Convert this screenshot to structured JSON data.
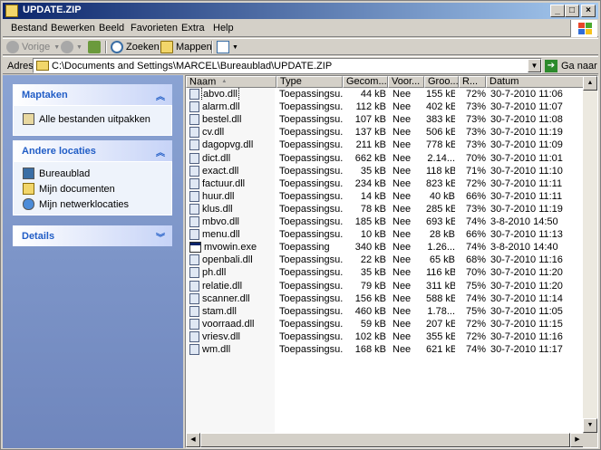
{
  "window": {
    "title": "UPDATE.ZIP"
  },
  "menu": [
    "Bestand",
    "Bewerken",
    "Beeld",
    "Favorieten",
    "Extra",
    "Help"
  ],
  "toolbar": {
    "back": "Vorige",
    "search": "Zoeken",
    "folders": "Mappen"
  },
  "address": {
    "label": "Adres",
    "value": "C:\\Documents and Settings\\MARCEL\\Bureaublad\\UPDATE.ZIP",
    "go": "Ga naar"
  },
  "tasks": {
    "title": "Maptaken",
    "items": [
      "Alle bestanden uitpakken"
    ]
  },
  "places": {
    "title": "Andere locaties",
    "items": [
      "Bureaublad",
      "Mijn documenten",
      "Mijn netwerklocaties"
    ]
  },
  "details": {
    "title": "Details"
  },
  "columns": {
    "name": "Naam",
    "type": "Type",
    "geco": "Gecom...",
    "voor": "Voor...",
    "groo": "Groo...",
    "r": "R...",
    "dat": "Datum"
  },
  "files": [
    {
      "name": "abvo.dll",
      "type": "Toepassingsu...",
      "geco": "44 kB",
      "voor": "Nee",
      "groo": "155 kB",
      "r": "72%",
      "dat": "30-7-2010 11:06",
      "icon": "dll"
    },
    {
      "name": "alarm.dll",
      "type": "Toepassingsu...",
      "geco": "112 kB",
      "voor": "Nee",
      "groo": "402 kB",
      "r": "73%",
      "dat": "30-7-2010 11:07",
      "icon": "dll"
    },
    {
      "name": "bestel.dll",
      "type": "Toepassingsu...",
      "geco": "107 kB",
      "voor": "Nee",
      "groo": "383 kB",
      "r": "73%",
      "dat": "30-7-2010 11:08",
      "icon": "dll"
    },
    {
      "name": "cv.dll",
      "type": "Toepassingsu...",
      "geco": "137 kB",
      "voor": "Nee",
      "groo": "506 kB",
      "r": "73%",
      "dat": "30-7-2010 11:19",
      "icon": "dll"
    },
    {
      "name": "dagopvg.dll",
      "type": "Toepassingsu...",
      "geco": "211 kB",
      "voor": "Nee",
      "groo": "778 kB",
      "r": "73%",
      "dat": "30-7-2010 11:09",
      "icon": "dll"
    },
    {
      "name": "dict.dll",
      "type": "Toepassingsu...",
      "geco": "662 kB",
      "voor": "Nee",
      "groo": "2.14...",
      "r": "70%",
      "dat": "30-7-2010 11:01",
      "icon": "dll"
    },
    {
      "name": "exact.dll",
      "type": "Toepassingsu...",
      "geco": "35 kB",
      "voor": "Nee",
      "groo": "118 kB",
      "r": "71%",
      "dat": "30-7-2010 11:10",
      "icon": "dll"
    },
    {
      "name": "factuur.dll",
      "type": "Toepassingsu...",
      "geco": "234 kB",
      "voor": "Nee",
      "groo": "823 kB",
      "r": "72%",
      "dat": "30-7-2010 11:11",
      "icon": "dll"
    },
    {
      "name": "huur.dll",
      "type": "Toepassingsu...",
      "geco": "14 kB",
      "voor": "Nee",
      "groo": "40 kB",
      "r": "66%",
      "dat": "30-7-2010 11:11",
      "icon": "dll"
    },
    {
      "name": "klus.dll",
      "type": "Toepassingsu...",
      "geco": "78 kB",
      "voor": "Nee",
      "groo": "285 kB",
      "r": "73%",
      "dat": "30-7-2010 11:19",
      "icon": "dll"
    },
    {
      "name": "mbvo.dll",
      "type": "Toepassingsu...",
      "geco": "185 kB",
      "voor": "Nee",
      "groo": "693 kB",
      "r": "74%",
      "dat": "3-8-2010 14:50",
      "icon": "dll"
    },
    {
      "name": "menu.dll",
      "type": "Toepassingsu...",
      "geco": "10 kB",
      "voor": "Nee",
      "groo": "28 kB",
      "r": "66%",
      "dat": "30-7-2010 11:13",
      "icon": "dll"
    },
    {
      "name": "mvowin.exe",
      "type": "Toepassing",
      "geco": "340 kB",
      "voor": "Nee",
      "groo": "1.26...",
      "r": "74%",
      "dat": "3-8-2010 14:40",
      "icon": "exe"
    },
    {
      "name": "openbali.dll",
      "type": "Toepassingsu...",
      "geco": "22 kB",
      "voor": "Nee",
      "groo": "65 kB",
      "r": "68%",
      "dat": "30-7-2010 11:16",
      "icon": "dll"
    },
    {
      "name": "ph.dll",
      "type": "Toepassingsu...",
      "geco": "35 kB",
      "voor": "Nee",
      "groo": "116 kB",
      "r": "70%",
      "dat": "30-7-2010 11:20",
      "icon": "dll"
    },
    {
      "name": "relatie.dll",
      "type": "Toepassingsu...",
      "geco": "79 kB",
      "voor": "Nee",
      "groo": "311 kB",
      "r": "75%",
      "dat": "30-7-2010 11:20",
      "icon": "dll"
    },
    {
      "name": "scanner.dll",
      "type": "Toepassingsu...",
      "geco": "156 kB",
      "voor": "Nee",
      "groo": "588 kB",
      "r": "74%",
      "dat": "30-7-2010 11:14",
      "icon": "dll"
    },
    {
      "name": "stam.dll",
      "type": "Toepassingsu...",
      "geco": "460 kB",
      "voor": "Nee",
      "groo": "1.78...",
      "r": "75%",
      "dat": "30-7-2010 11:05",
      "icon": "dll"
    },
    {
      "name": "voorraad.dll",
      "type": "Toepassingsu...",
      "geco": "59 kB",
      "voor": "Nee",
      "groo": "207 kB",
      "r": "72%",
      "dat": "30-7-2010 11:15",
      "icon": "dll"
    },
    {
      "name": "vriesv.dll",
      "type": "Toepassingsu...",
      "geco": "102 kB",
      "voor": "Nee",
      "groo": "355 kB",
      "r": "72%",
      "dat": "30-7-2010 11:16",
      "icon": "dll"
    },
    {
      "name": "wm.dll",
      "type": "Toepassingsu...",
      "geco": "168 kB",
      "voor": "Nee",
      "groo": "621 kB",
      "r": "74%",
      "dat": "30-7-2010 11:17",
      "icon": "dll"
    }
  ]
}
